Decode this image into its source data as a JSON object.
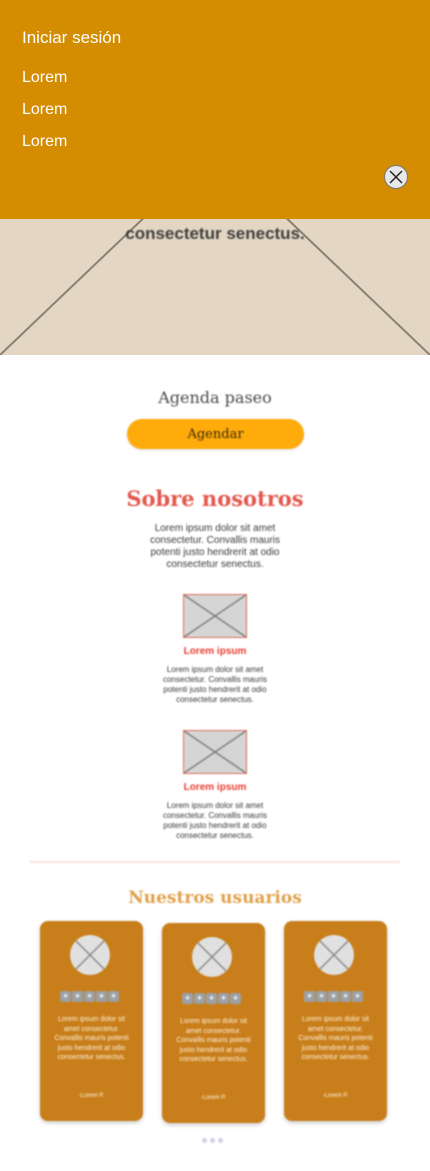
{
  "menu": {
    "login": "Iniciar sesión",
    "items": [
      "Lorem",
      "Lorem",
      "Lorem"
    ]
  },
  "hero": {
    "line1": "",
    "line2": "consectetur senectus."
  },
  "agenda": {
    "title": "Agenda paseo",
    "button": "Agendar"
  },
  "about": {
    "title": "Sobre nosotros",
    "text": "Lorem ipsum dolor sit amet consectetur. Convallis mauris potenti justo hendrerit at odio consectetur senectus.",
    "features": [
      {
        "title": "Lorem ipsum",
        "text": "Lorem ipsum dolor sit amet consectetur. Convallis mauris potenti justo hendrerit at odio consectetur senectus."
      },
      {
        "title": "Lorem ipsum",
        "text": "Lorem ipsum dolor sit amet consectetur. Convallis mauris potenti justo hendrerit at odio consectetur senectus."
      }
    ]
  },
  "users": {
    "title": "Nuestros usuarios",
    "cards": [
      {
        "text": "Lorem ipsum dolor sit amet consectetur. Convallis mauris potenti justo hendrerit at odio consectetur senectus.",
        "author": "-Lorem P.",
        "rating": 5
      },
      {
        "text": "Lorem ipsum dolor sit amet consectetur. Convallis mauris potenti justo hendrerit at odio consectetur senectus.",
        "author": "-Lorem P.",
        "rating": 5
      },
      {
        "text": "Lorem ipsum dolor sit amet consectetur. Convallis mauris potenti justo hendrerit at odio consectetur senectus.",
        "author": "-Lorem P.",
        "rating": 5
      }
    ],
    "pagination_count": 3
  },
  "colors": {
    "menu_bg": "#d48c01",
    "accent_button": "#ffab0c",
    "section_title": "#e3574c",
    "card_bg": "#c87e1a"
  },
  "icons": {
    "close": "close-icon",
    "star": "star-icon"
  }
}
